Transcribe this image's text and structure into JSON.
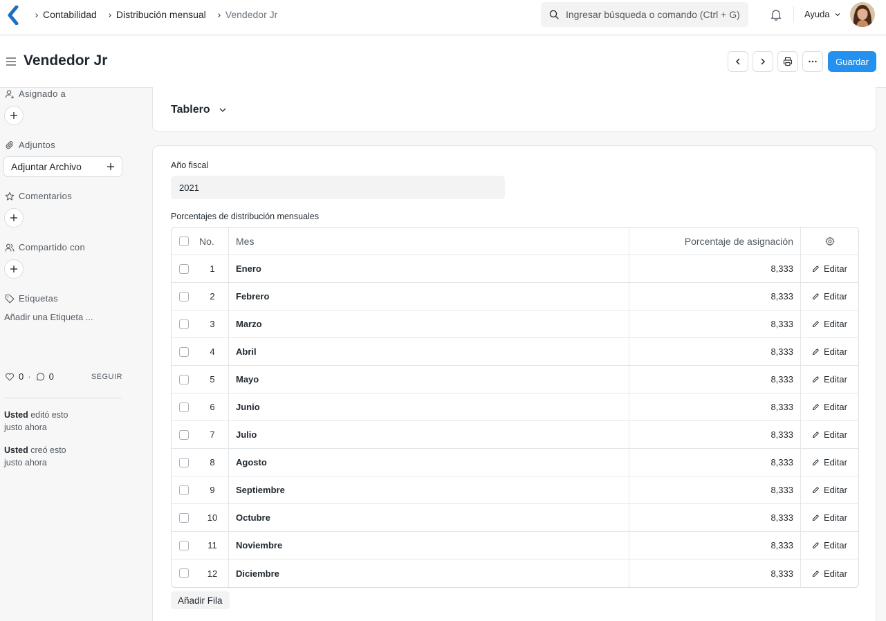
{
  "navbar": {
    "breadcrumbs": [
      "Contabilidad",
      "Distribución mensual",
      "Vendedor Jr"
    ],
    "search_placeholder": "Ingresar búsqueda o comando (Ctrl + G)",
    "help_label": "Ayuda"
  },
  "page": {
    "title": "Vendedor Jr",
    "save_label": "Guardar"
  },
  "sidebar": {
    "assigned_label": "Asignado a",
    "attachments_label": "Adjuntos",
    "attach_button": "Adjuntar Archivo",
    "comments_label": "Comentarios",
    "shared_label": "Compartido con",
    "tags_label": "Etiquetas",
    "add_tag": "Añadir una Etiqueta ...",
    "likes": "0",
    "comments_count": "0",
    "follow": "SEGUIR",
    "activity": [
      {
        "user": "Usted",
        "action": "editó esto",
        "time": "justo ahora"
      },
      {
        "user": "Usted",
        "action": "creó esto",
        "time": "justo ahora"
      }
    ]
  },
  "dashboard": {
    "title": "Tablero"
  },
  "form": {
    "fiscal_year_label": "Año fiscal",
    "fiscal_year_value": "2021",
    "table_label": "Porcentajes de distribución mensuales",
    "columns": {
      "no": "No.",
      "month": "Mes",
      "pct": "Porcentaje de asignación"
    },
    "edit_label": "Editar",
    "rows": [
      {
        "no": "1",
        "month": "Enero",
        "pct": "8,333"
      },
      {
        "no": "2",
        "month": "Febrero",
        "pct": "8,333"
      },
      {
        "no": "3",
        "month": "Marzo",
        "pct": "8,333"
      },
      {
        "no": "4",
        "month": "Abril",
        "pct": "8,333"
      },
      {
        "no": "5",
        "month": "Mayo",
        "pct": "8,333"
      },
      {
        "no": "6",
        "month": "Junio",
        "pct": "8,333"
      },
      {
        "no": "7",
        "month": "Julio",
        "pct": "8,333"
      },
      {
        "no": "8",
        "month": "Agosto",
        "pct": "8,333"
      },
      {
        "no": "9",
        "month": "Septiembre",
        "pct": "8,333"
      },
      {
        "no": "10",
        "month": "Octubre",
        "pct": "8,333"
      },
      {
        "no": "11",
        "month": "Noviembre",
        "pct": "8,333"
      },
      {
        "no": "12",
        "month": "Diciembre",
        "pct": "8,333"
      }
    ],
    "add_row": "Añadir Fila"
  },
  "colors": {
    "primary": "#2490ef",
    "logo": "#1f6fbf"
  }
}
